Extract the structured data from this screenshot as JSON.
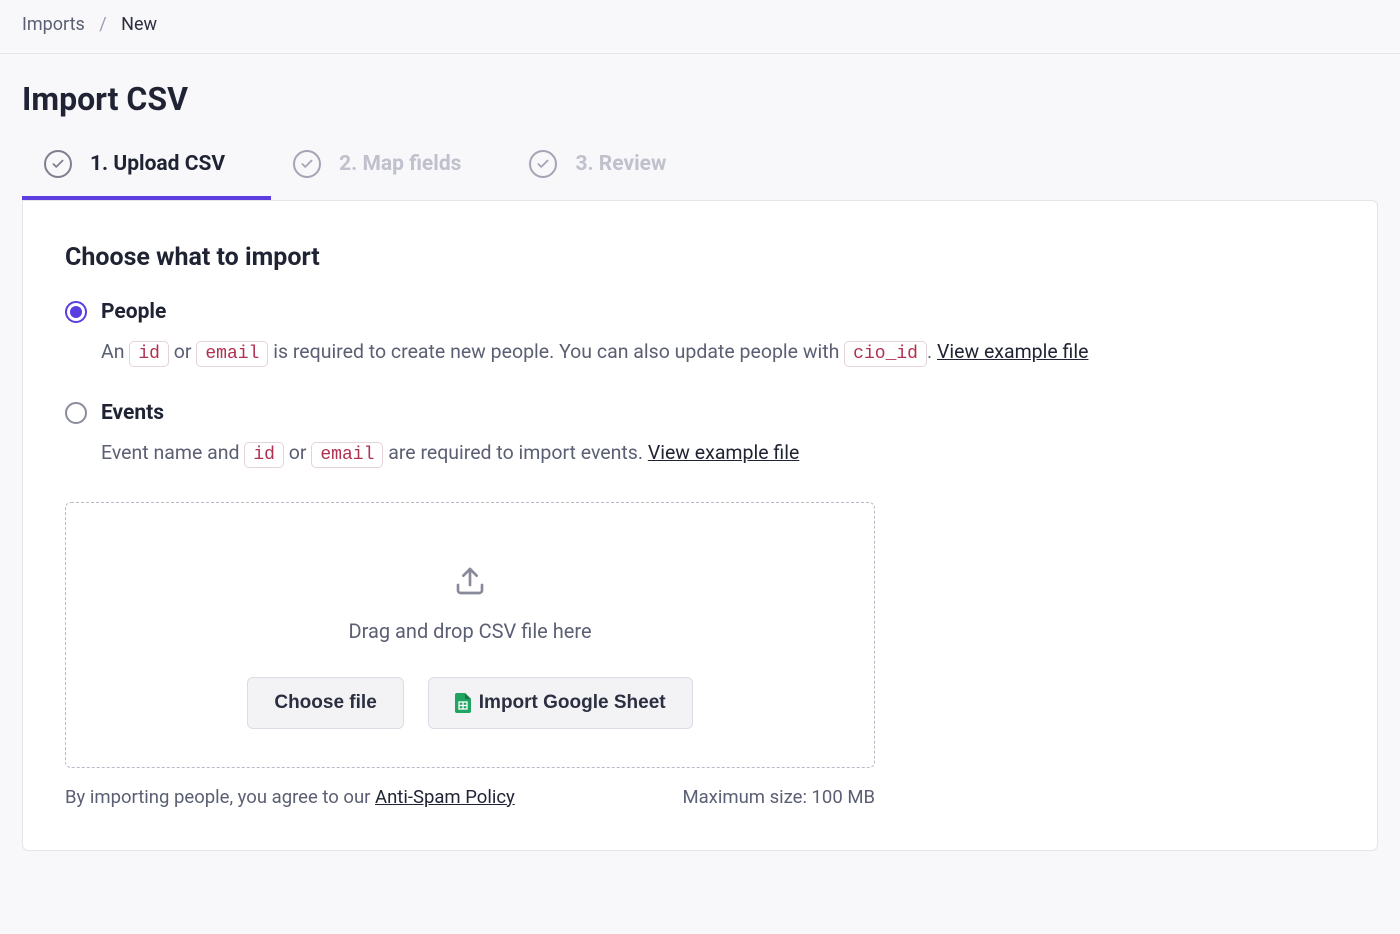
{
  "breadcrumb": {
    "parent": "Imports",
    "current": "New"
  },
  "page_title": "Import CSV",
  "tabs": [
    {
      "label": "1. Upload CSV",
      "active": true
    },
    {
      "label": "2. Map fields",
      "active": false
    },
    {
      "label": "3. Review",
      "active": false
    }
  ],
  "section_title": "Choose what to import",
  "options": {
    "people": {
      "label": "People",
      "desc_prefix": "An ",
      "chip1": "id",
      "desc_or": " or ",
      "chip2": "email",
      "desc_mid": " is required to create new people. You can also update people with ",
      "chip3": "cio_id",
      "desc_suffix": ". ",
      "link": "View example file"
    },
    "events": {
      "label": "Events",
      "desc_prefix": "Event name and ",
      "chip1": "id",
      "desc_or": " or ",
      "chip2": "email",
      "desc_suffix": " are required to import events. ",
      "link": "View example file"
    }
  },
  "dropzone": {
    "text": "Drag and drop CSV file here",
    "choose_file": "Choose file",
    "import_sheet": "Import Google Sheet"
  },
  "footer": {
    "agree_prefix": "By importing people, you agree to our ",
    "policy_link": "Anti-Spam Policy",
    "max_size": "Maximum size: 100 MB"
  }
}
